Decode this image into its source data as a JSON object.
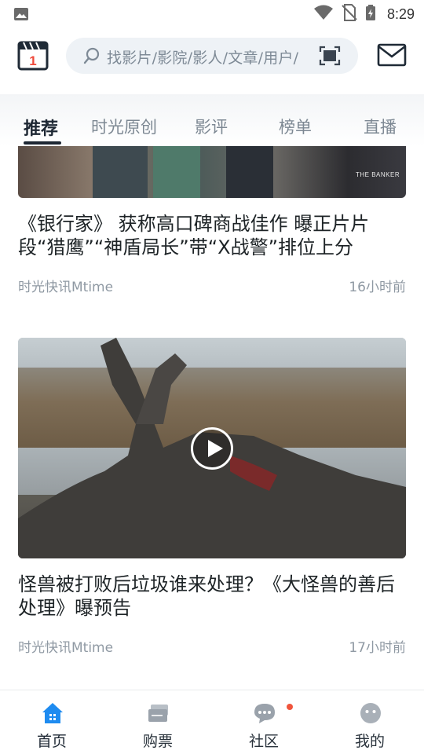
{
  "status_bar": {
    "time": "8:29",
    "icons": [
      "image-icon",
      "wifi-icon",
      "no-sim-icon",
      "battery-charging-icon"
    ]
  },
  "header": {
    "calendar_day": "1",
    "search_placeholder": "找影片/影院/影人/文章/用户/",
    "icons": [
      "calendar-icon",
      "search-icon",
      "scan-icon",
      "mail-icon"
    ]
  },
  "tabs": [
    {
      "label": "推荐",
      "active": true
    },
    {
      "label": "时光原创",
      "active": false
    },
    {
      "label": "影评",
      "active": false
    },
    {
      "label": "榜单",
      "active": false
    },
    {
      "label": "直播",
      "active": false
    }
  ],
  "feed": [
    {
      "image_caption": "THE BANKER",
      "title": "《银行家》 获称高口碑商战佳作 曝正片片段“猎鹰”“神盾局长”带“X战警”排位上分",
      "source": "时光快讯Mtime",
      "time": "16小时前",
      "has_video": false
    },
    {
      "title": "怪兽被打败后垃圾谁来处理？《大怪兽的善后处理》曝预告",
      "source": "时光快讯Mtime",
      "time": "17小时前",
      "has_video": true
    }
  ],
  "bottom_nav": [
    {
      "label": "首页",
      "icon": "home-icon",
      "active": true
    },
    {
      "label": "购票",
      "icon": "ticket-icon",
      "active": false
    },
    {
      "label": "社区",
      "icon": "chat-icon",
      "active": false,
      "badge": true
    },
    {
      "label": "我的",
      "icon": "profile-icon",
      "active": false
    }
  ],
  "colors": {
    "accent_blue": "#1e8bf0",
    "badge_red": "#f0543c",
    "text_dark": "#1d2326",
    "text_muted": "#8f99a3"
  }
}
